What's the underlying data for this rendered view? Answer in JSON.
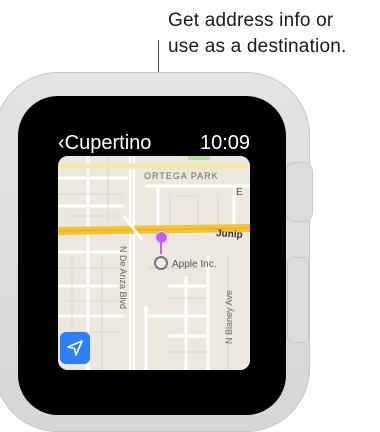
{
  "callout": {
    "line1": "Get address info or",
    "line2": "use as a destination."
  },
  "status": {
    "back_glyph": "‹",
    "back_label": "Cupertino",
    "time": "10:09"
  },
  "map": {
    "labels": {
      "ortega_park": "ORTEGA PARK",
      "e_street": "E",
      "juniper": "Junip",
      "apple": "Apple Inc.",
      "de_anza": "N De Anza Blvd",
      "blaney": "N Blaney Ave"
    },
    "pin_color": "#c560e6",
    "road_highlight_color": "#f5c331",
    "locate_button_color": "#2d7ff9",
    "locate_icon": "location-arrow-icon"
  }
}
